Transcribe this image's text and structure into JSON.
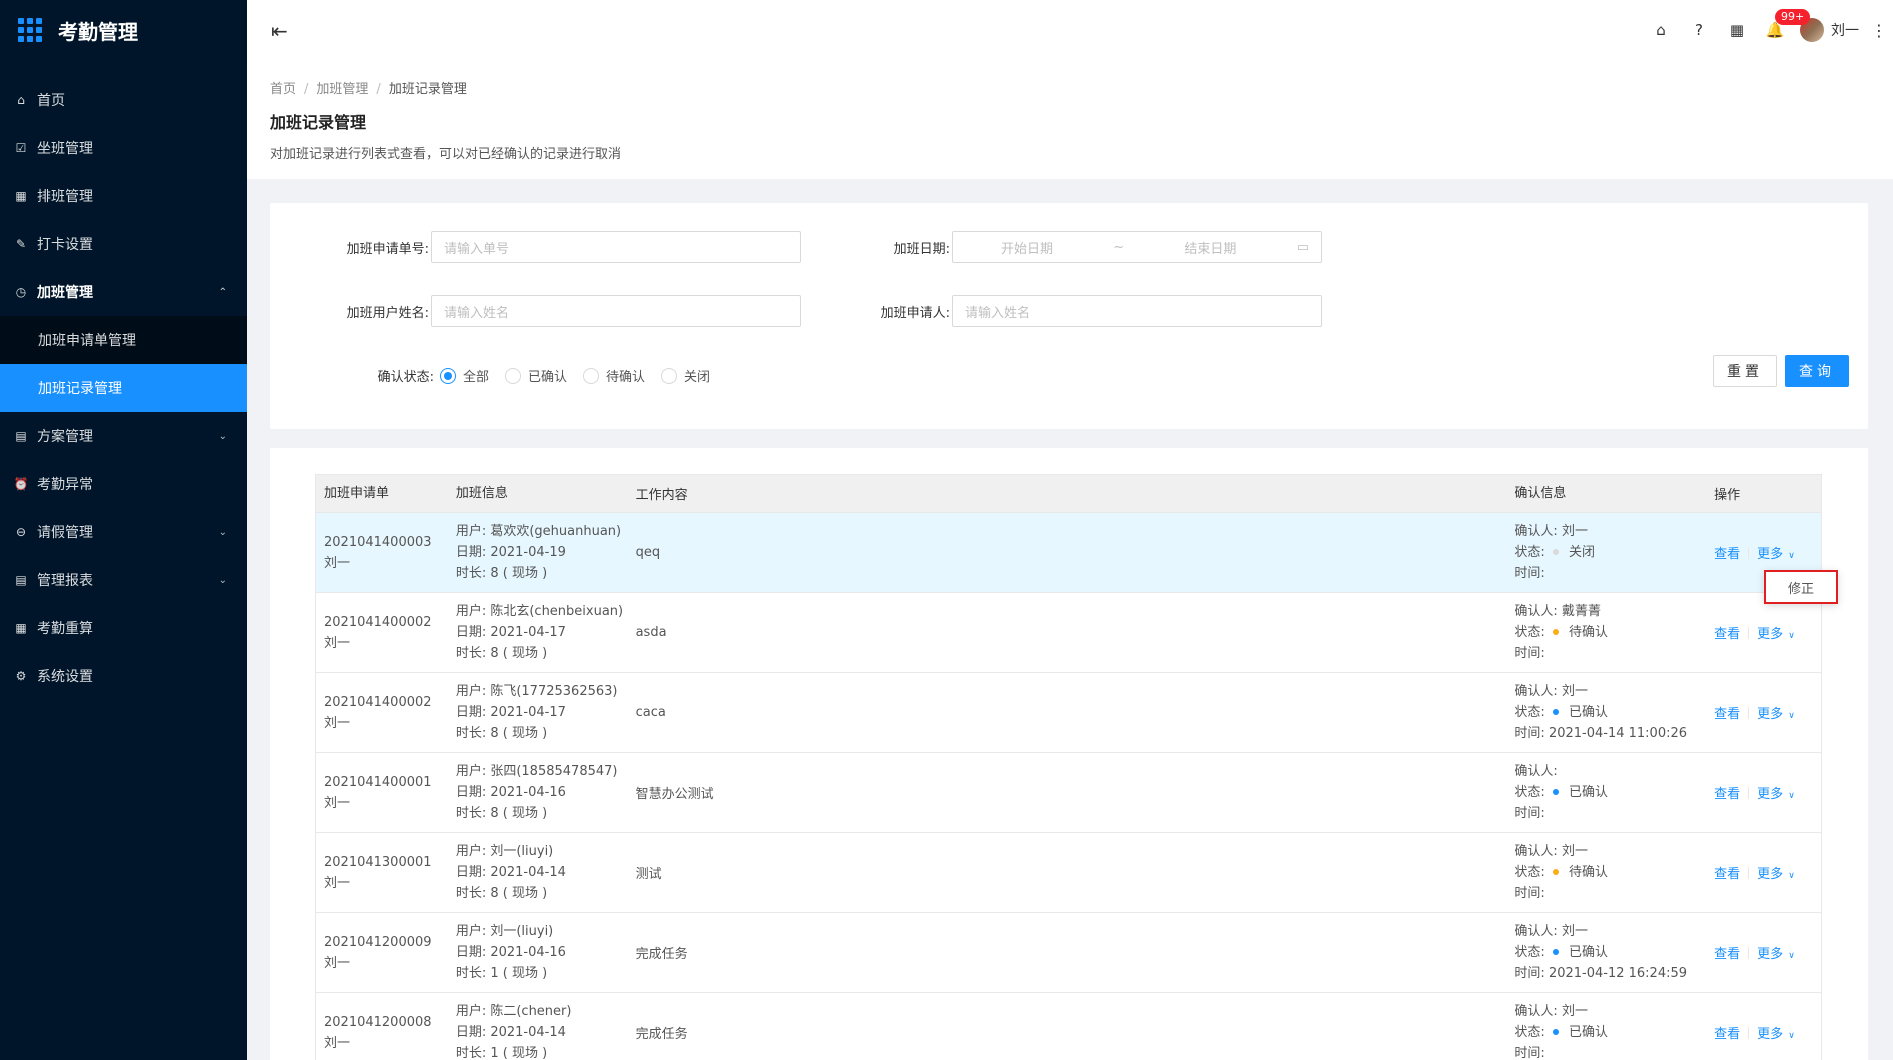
{
  "app": {
    "title": "考勤管理"
  },
  "sidebar": {
    "items": [
      {
        "label": "首页",
        "icon": "home-icon",
        "glyph": "⌂"
      },
      {
        "label": "坐班管理",
        "icon": "calendar-check-icon",
        "glyph": "☑"
      },
      {
        "label": "排班管理",
        "icon": "calendar-icon",
        "glyph": "▦"
      },
      {
        "label": "打卡设置",
        "icon": "edit-icon",
        "glyph": "✎"
      },
      {
        "label": "加班管理",
        "icon": "clock-icon",
        "glyph": "◷",
        "arrow": "⌃"
      },
      {
        "label": "加班申请单管理"
      },
      {
        "label": "加班记录管理"
      },
      {
        "label": "方案管理",
        "icon": "file-icon",
        "glyph": "▤",
        "arrow": "⌄"
      },
      {
        "label": "考勤异常",
        "icon": "alarm-icon",
        "glyph": "⏰"
      },
      {
        "label": "请假管理",
        "icon": "leave-icon",
        "glyph": "⊖",
        "arrow": "⌄"
      },
      {
        "label": "管理报表",
        "icon": "report-icon",
        "glyph": "▤",
        "arrow": "⌄"
      },
      {
        "label": "考勤重算",
        "icon": "calc-icon",
        "glyph": "▦"
      },
      {
        "label": "系统设置",
        "icon": "gear-icon",
        "glyph": "⚙"
      }
    ]
  },
  "header": {
    "fold_icon": "⇤",
    "icons": {
      "home": "⌂",
      "help": "?",
      "apps": "▦",
      "bell": "🔔",
      "more": "⋮"
    },
    "badge": "99+",
    "username": "刘一"
  },
  "breadcrumb": [
    "首页",
    "加班管理",
    "加班记录管理"
  ],
  "page": {
    "title": "加班记录管理",
    "description": "对加班记录进行列表式查看，可以对已经确认的记录进行取消"
  },
  "filters": {
    "order_no_label": "加班申请单号:",
    "order_no_placeholder": "请输入单号",
    "date_label": "加班日期:",
    "date_start_placeholder": "开始日期",
    "date_sep": "~",
    "date_end_placeholder": "结束日期",
    "user_label": "加班用户姓名:",
    "user_placeholder": "请输入姓名",
    "applicant_label": "加班申请人:",
    "applicant_placeholder": "请输入姓名",
    "status_label": "确认状态:",
    "status_options": [
      "全部",
      "已确认",
      "待确认",
      "关闭"
    ],
    "status_selected": "全部",
    "reset_label": "重置",
    "search_label": "查询"
  },
  "table": {
    "headers": [
      "加班申请单",
      "加班信息",
      "工作内容",
      "确认信息",
      "操作"
    ],
    "user_prefix": "用户: ",
    "date_prefix": "日期: ",
    "duration_prefix": "时长: ",
    "confirmer_prefix": "确认人: ",
    "status_prefix": "状态: ",
    "time_prefix": "时间: ",
    "action_view": "查看",
    "action_more": "更多",
    "rows": [
      {
        "no": "2021041400003",
        "owner": "刘一",
        "user": "葛欢欢(gehuanhuan)",
        "date": "2021-04-19",
        "duration": "8 ( 现场 )",
        "content": "qeq",
        "confirmer": "刘一",
        "status": "关闭",
        "status_color": "#d9d9d9",
        "time": ""
      },
      {
        "no": "2021041400002",
        "owner": "刘一",
        "user": "陈北玄(chenbeixuan)",
        "date": "2021-04-17",
        "duration": "8 ( 现场 )",
        "content": "asda",
        "confirmer": "戴菁菁",
        "status": "待确认",
        "status_color": "#faad14",
        "time": ""
      },
      {
        "no": "2021041400002",
        "owner": "刘一",
        "user": "陈飞(17725362563)",
        "date": "2021-04-17",
        "duration": "8 ( 现场 )",
        "content": "caca",
        "confirmer": "刘一",
        "status": "已确认",
        "status_color": "#1890ff",
        "time": "2021-04-14 11:00:26"
      },
      {
        "no": "2021041400001",
        "owner": "刘一",
        "user": "张四(18585478547)",
        "date": "2021-04-16",
        "duration": "8 ( 现场 )",
        "content": "智慧办公测试",
        "confirmer": "",
        "status": "已确认",
        "status_color": "#1890ff",
        "time": ""
      },
      {
        "no": "2021041300001",
        "owner": "刘一",
        "user": "刘一(liuyi)",
        "date": "2021-04-14",
        "duration": "8 ( 现场 )",
        "content": "测试",
        "confirmer": "刘一",
        "status": "待确认",
        "status_color": "#faad14",
        "time": ""
      },
      {
        "no": "2021041200009",
        "owner": "刘一",
        "user": "刘一(liuyi)",
        "date": "2021-04-16",
        "duration": "1 ( 现场 )",
        "content": "完成任务",
        "confirmer": "刘一",
        "status": "已确认",
        "status_color": "#1890ff",
        "time": "2021-04-12 16:24:59"
      },
      {
        "no": "2021041200008",
        "owner": "刘一",
        "user": "陈二(chener)",
        "date": "2021-04-14",
        "duration": "1 ( 现场 )",
        "content": "完成任务",
        "confirmer": "刘一",
        "status": "已确认",
        "status_color": "#1890ff",
        "time": ""
      }
    ]
  },
  "dropdown": {
    "item": "修正"
  }
}
